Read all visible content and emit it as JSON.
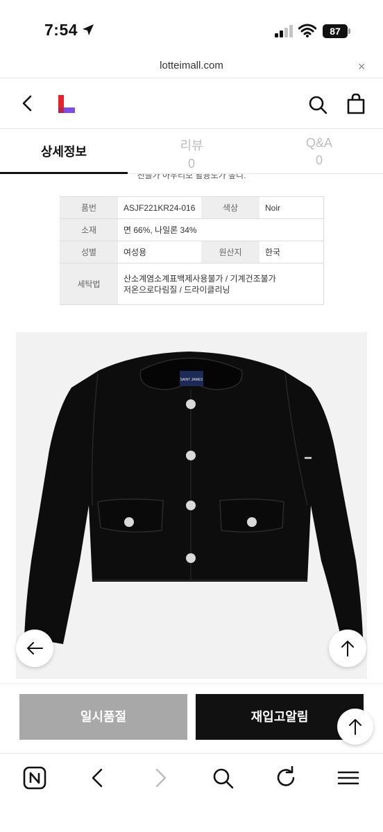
{
  "status_bar": {
    "time": "7:54",
    "battery": "87"
  },
  "url_bar": {
    "url": "lotteimall.com",
    "close": "×"
  },
  "tabs": [
    {
      "label": "상세정보",
      "count": ""
    },
    {
      "label": "리뷰",
      "count": "0"
    },
    {
      "label": "Q&A",
      "count": "0"
    }
  ],
  "cut_note": "천을가 아우티보 활용도가 높니.",
  "spec": {
    "rows": [
      {
        "label": "품번",
        "value": "ASJF221KR24-016",
        "label2": "색상",
        "value2": "Noir"
      },
      {
        "label": "소재",
        "value": "면 66%, 나일론 34%"
      },
      {
        "label": "성별",
        "value": "여성용",
        "label2": "원산지",
        "value2": "한국"
      },
      {
        "label": "세탁법",
        "value_line1": "산소계염소계표백제사용불가 / 기계건조불가",
        "value_line2": "저온으로다림질 / 드라이클리닝"
      }
    ]
  },
  "product": {
    "brand_label": "SAINT JAMES"
  },
  "actions": {
    "soldout": "일시품절",
    "restock": "재입고알림"
  },
  "colors": {
    "accent_red": "#e5242b",
    "accent_purple": "#7b4fe0",
    "soldout_gray": "#a8a8a8",
    "black": "#111111"
  }
}
